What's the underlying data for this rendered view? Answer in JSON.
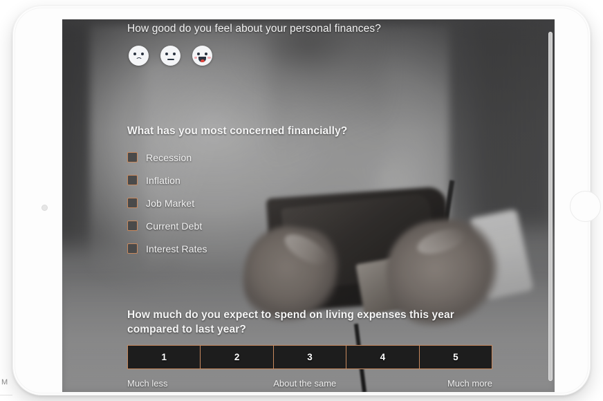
{
  "device": {
    "type": "tablet",
    "frame_color": "#fdfdfd",
    "home_button_name": "home-button",
    "camera_name": "front-camera"
  },
  "survey": {
    "q1": {
      "title": "How good do you feel about your personal finances?",
      "type": "emoji-rating",
      "options": [
        {
          "name": "sad-face",
          "label": "Sad"
        },
        {
          "name": "neutral-face",
          "label": "Neutral"
        },
        {
          "name": "happy-face",
          "label": "Happy"
        }
      ]
    },
    "q2": {
      "title": "What has you most concerned financially?",
      "type": "checkbox-list",
      "options": [
        {
          "label": "Recession",
          "checked": false
        },
        {
          "label": "Inflation",
          "checked": false
        },
        {
          "label": "Job Market",
          "checked": false
        },
        {
          "label": "Current Debt",
          "checked": false
        },
        {
          "label": "Interest Rates",
          "checked": false
        }
      ]
    },
    "q3": {
      "title": "How much do you expect to spend on living expenses this year compared to last year?",
      "type": "likert-scale",
      "values": [
        "1",
        "2",
        "3",
        "4",
        "5"
      ],
      "anchor_low": "Much less",
      "anchor_mid": "About the same",
      "anchor_high": "Much more",
      "selected": null
    }
  },
  "colors": {
    "accent_border": "#c98a5f",
    "button_fill": "#1d1d1d",
    "checkbox_fill": "#4a4a4a",
    "text": "#f3f3f3",
    "scrollbar": "#c9c9c9"
  },
  "background_fragment": {
    "text": "M"
  }
}
